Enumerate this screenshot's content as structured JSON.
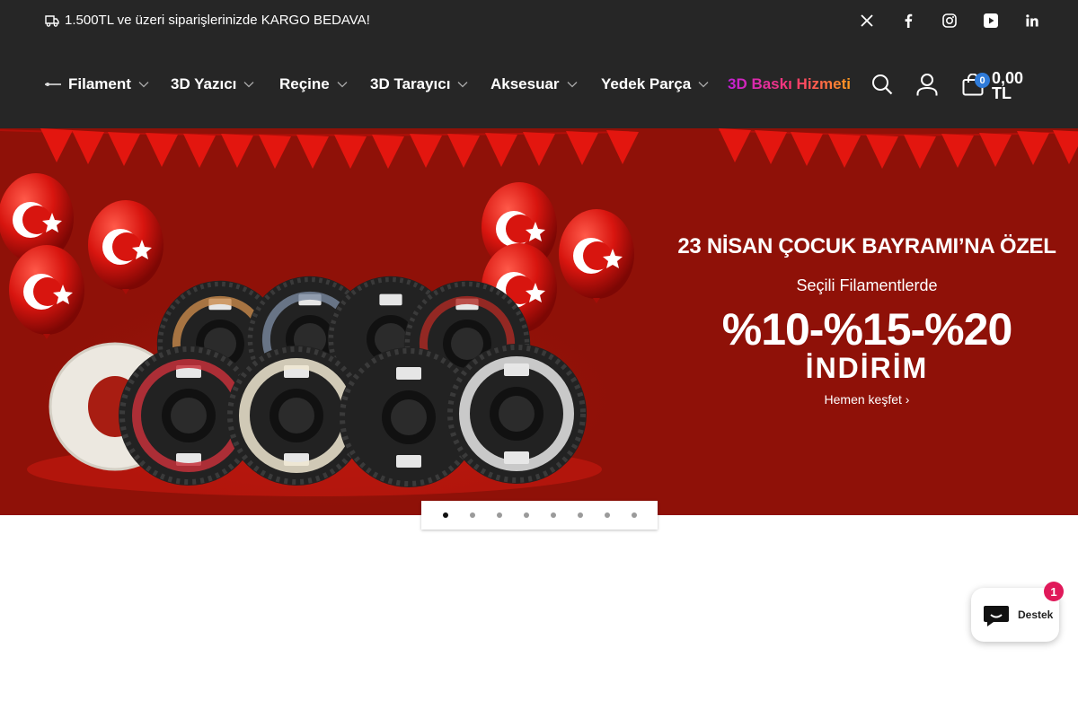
{
  "announcement": {
    "text": "1.500TL ve üzeri siparişlerinizde KARGO BEDAVA!",
    "icon": "truck-icon"
  },
  "social": [
    "x-icon",
    "facebook-icon",
    "instagram-icon",
    "youtube-icon",
    "linkedin-icon"
  ],
  "nav": {
    "items": [
      {
        "label": "Filament"
      },
      {
        "label": "3D Yazıcı"
      },
      {
        "label": "Reçine"
      },
      {
        "label": "3D Tarayıcı"
      },
      {
        "label": "Aksesuar"
      },
      {
        "label": "Yedek Parça"
      },
      {
        "label": "3D Baskı Hizmeti"
      }
    ]
  },
  "header": {
    "cart_count": "0",
    "cart_total": "0,00 TL"
  },
  "hero": {
    "title": "23 NİSAN ÇOCUK BAYRAMI’NA ÖZEL",
    "subtitle": "Seçili Filamentlerde",
    "percent": "%10-%15-%20",
    "discount": "İNDİRİM",
    "cta": "Hemen keşfet ›",
    "colors": {
      "background": "#8f1108",
      "flags": "#e3160f"
    }
  },
  "slider": {
    "count": 8,
    "active": 0
  },
  "chat": {
    "label": "Destek",
    "badge": "1"
  }
}
